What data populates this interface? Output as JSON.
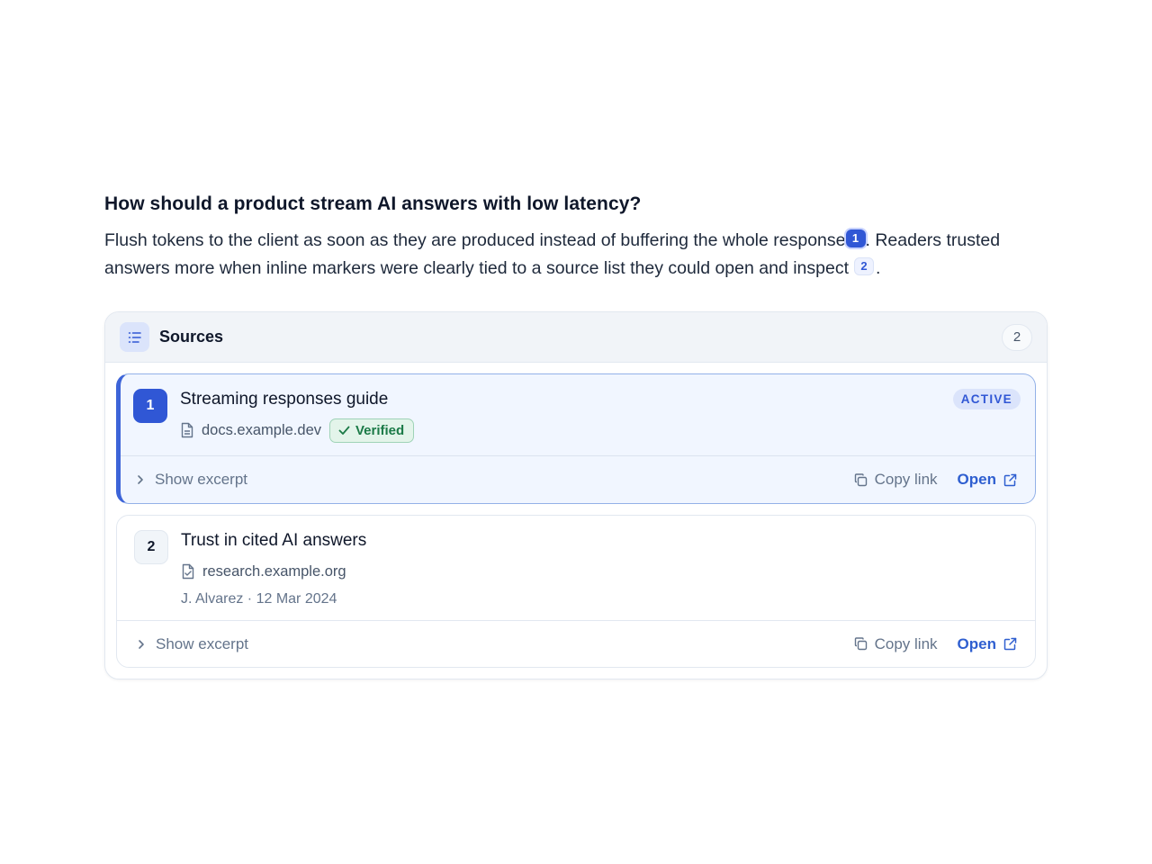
{
  "question": "How should a product stream AI answers with low latency?",
  "answer": {
    "part1": "Flush tokens to the client as soon as they are produced instead of buffering the whole response",
    "cite1": "1",
    "part2": ". Readers trusted answers more when inline markers were clearly tied to a source list they could open and inspect",
    "cite2": "2",
    "part3": "."
  },
  "sources": {
    "title": "Sources",
    "count": "2",
    "items": [
      {
        "number": "1",
        "title": "Streaming responses guide",
        "domain": "docs.example.dev",
        "verified_label": "Verified",
        "badge": "ACTIVE",
        "show_excerpt": "Show excerpt",
        "copy_link": "Copy link",
        "open": "Open"
      },
      {
        "number": "2",
        "title": "Trust in cited AI answers",
        "domain": "research.example.org",
        "byline": "J. Alvarez · 12 Mar 2024",
        "show_excerpt": "Show excerpt",
        "copy_link": "Copy link",
        "open": "Open"
      }
    ]
  },
  "colors": {
    "accent": "#3057d5",
    "verified": "#1b7a47",
    "link": "#2f5fd0"
  }
}
